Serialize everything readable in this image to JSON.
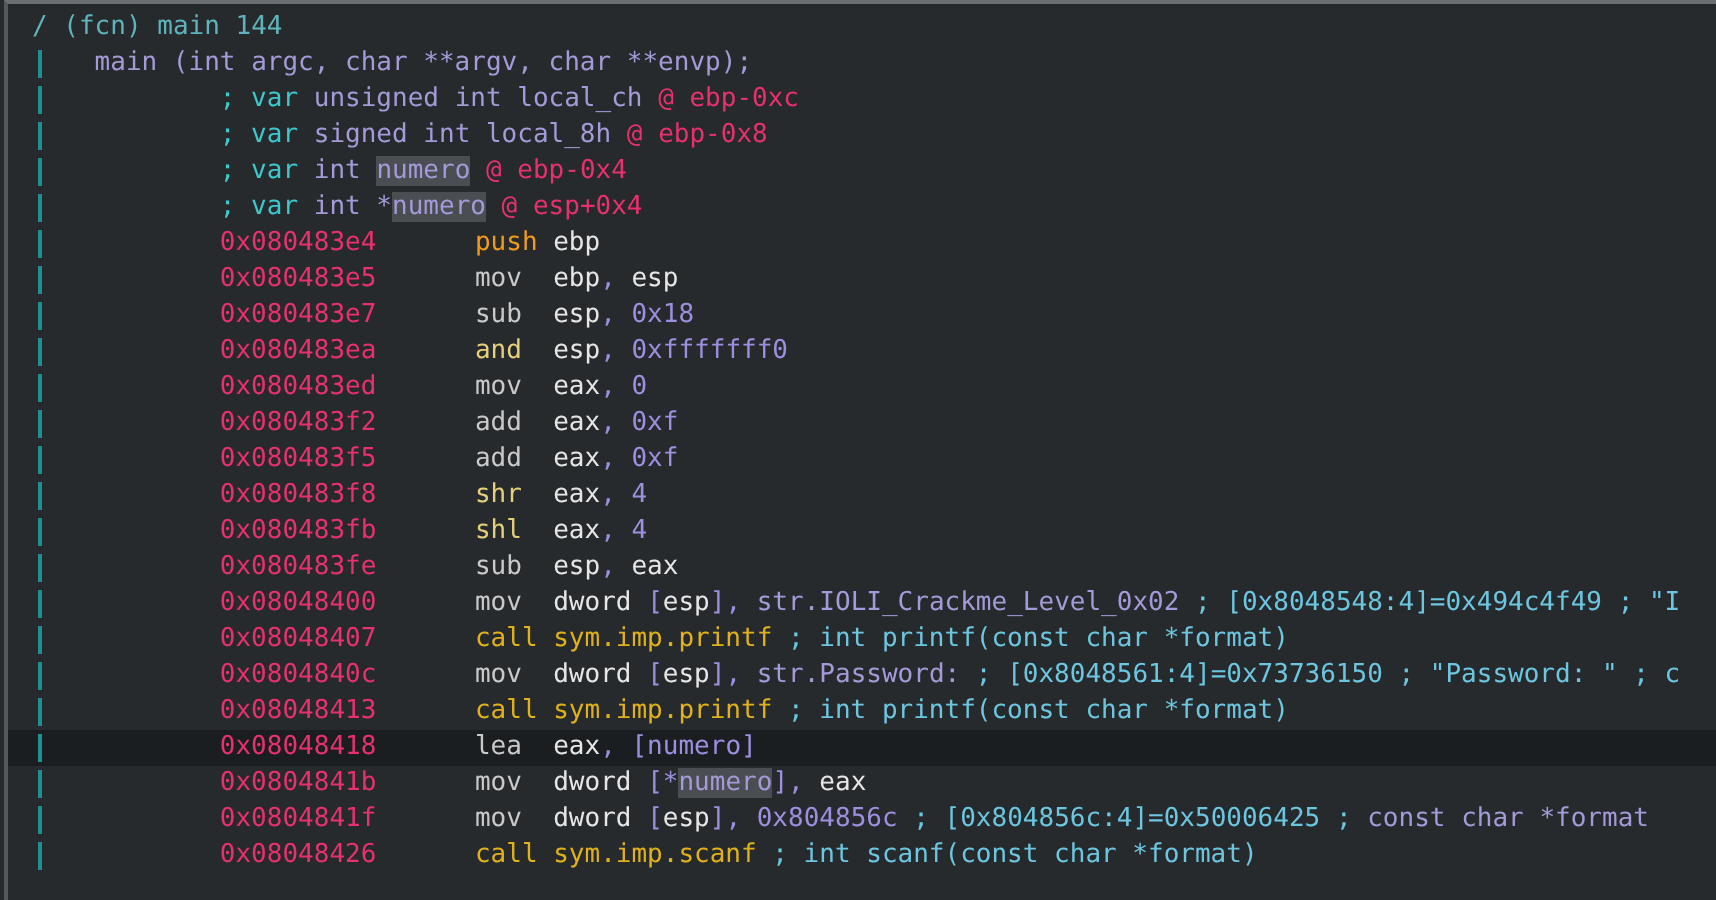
{
  "function": {
    "header": "/ (fcn) main 144",
    "signature": "main (int argc, char **argv, char **envp);",
    "variables": [
      [
        {
          "kind": "cmt",
          "text": "; var "
        },
        {
          "kind": "type",
          "text": "unsigned int local_ch "
        },
        {
          "kind": "loc",
          "text": "@ ebp-0xc"
        }
      ],
      [
        {
          "kind": "cmt",
          "text": "; var "
        },
        {
          "kind": "type",
          "text": "signed int local_8h "
        },
        {
          "kind": "loc",
          "text": "@ ebp-0x8"
        }
      ],
      [
        {
          "kind": "cmt",
          "text": "; var "
        },
        {
          "kind": "type",
          "text": "int "
        },
        {
          "kind": "hl",
          "text": "numero"
        },
        {
          "kind": "loc",
          "text": " @ ebp-0x4"
        }
      ],
      [
        {
          "kind": "cmt",
          "text": "; var "
        },
        {
          "kind": "type",
          "text": "int *"
        },
        {
          "kind": "hl",
          "text": "numero"
        },
        {
          "kind": "loc",
          "text": " @ esp+0x4"
        }
      ]
    ],
    "instructions": [
      {
        "address": "0x080483e4",
        "mnemonic": "push",
        "kind": "stack",
        "selected": false,
        "operands": [
          {
            "kind": "reg",
            "text": "ebp"
          }
        ]
      },
      {
        "address": "0x080483e5",
        "mnemonic": "mov",
        "kind": "move",
        "selected": false,
        "operands": [
          {
            "kind": "reg",
            "text": "ebp"
          },
          {
            "kind": "pun",
            "text": ", "
          },
          {
            "kind": "reg",
            "text": "esp"
          }
        ]
      },
      {
        "address": "0x080483e7",
        "mnemonic": "sub",
        "kind": "move",
        "selected": false,
        "operands": [
          {
            "kind": "reg",
            "text": "esp"
          },
          {
            "kind": "pun",
            "text": ", "
          },
          {
            "kind": "num",
            "text": "0x18"
          }
        ]
      },
      {
        "address": "0x080483ea",
        "mnemonic": "and",
        "kind": "logic",
        "selected": false,
        "operands": [
          {
            "kind": "reg",
            "text": "esp"
          },
          {
            "kind": "pun",
            "text": ", "
          },
          {
            "kind": "num",
            "text": "0xfffffff0"
          }
        ]
      },
      {
        "address": "0x080483ed",
        "mnemonic": "mov",
        "kind": "move",
        "selected": false,
        "operands": [
          {
            "kind": "reg",
            "text": "eax"
          },
          {
            "kind": "pun",
            "text": ", "
          },
          {
            "kind": "num",
            "text": "0"
          }
        ]
      },
      {
        "address": "0x080483f2",
        "mnemonic": "add",
        "kind": "move",
        "selected": false,
        "operands": [
          {
            "kind": "reg",
            "text": "eax"
          },
          {
            "kind": "pun",
            "text": ", "
          },
          {
            "kind": "num",
            "text": "0xf"
          }
        ]
      },
      {
        "address": "0x080483f5",
        "mnemonic": "add",
        "kind": "move",
        "selected": false,
        "operands": [
          {
            "kind": "reg",
            "text": "eax"
          },
          {
            "kind": "pun",
            "text": ", "
          },
          {
            "kind": "num",
            "text": "0xf"
          }
        ]
      },
      {
        "address": "0x080483f8",
        "mnemonic": "shr",
        "kind": "logic",
        "selected": false,
        "operands": [
          {
            "kind": "reg",
            "text": "eax"
          },
          {
            "kind": "pun",
            "text": ", "
          },
          {
            "kind": "num",
            "text": "4"
          }
        ]
      },
      {
        "address": "0x080483fb",
        "mnemonic": "shl",
        "kind": "logic",
        "selected": false,
        "operands": [
          {
            "kind": "reg",
            "text": "eax"
          },
          {
            "kind": "pun",
            "text": ", "
          },
          {
            "kind": "num",
            "text": "4"
          }
        ]
      },
      {
        "address": "0x080483fe",
        "mnemonic": "sub",
        "kind": "move",
        "selected": false,
        "operands": [
          {
            "kind": "reg",
            "text": "esp"
          },
          {
            "kind": "pun",
            "text": ", "
          },
          {
            "kind": "reg",
            "text": "eax"
          }
        ]
      },
      {
        "address": "0x08048400",
        "mnemonic": "mov",
        "kind": "move",
        "selected": false,
        "operands": [
          {
            "kind": "reg",
            "text": "dword "
          },
          {
            "kind": "pun",
            "text": "["
          },
          {
            "kind": "reg",
            "text": "esp"
          },
          {
            "kind": "pun",
            "text": "], "
          },
          {
            "kind": "str",
            "text": "str.IOLI_Crackme_Level_0x02"
          }
        ],
        "comment": [
          {
            "kind": "cmt",
            "text": "; [0x8048548:4]=0x494c4f49 ; \"I"
          }
        ]
      },
      {
        "address": "0x08048407",
        "mnemonic": "call",
        "kind": "call",
        "selected": false,
        "operands": [
          {
            "kind": "sym",
            "text": "sym.imp.printf"
          }
        ],
        "comment": [
          {
            "kind": "cmt",
            "text": "; int printf(const char *format)"
          }
        ]
      },
      {
        "address": "0x0804840c",
        "mnemonic": "mov",
        "kind": "move",
        "selected": false,
        "operands": [
          {
            "kind": "reg",
            "text": "dword "
          },
          {
            "kind": "pun",
            "text": "["
          },
          {
            "kind": "reg",
            "text": "esp"
          },
          {
            "kind": "pun",
            "text": "], "
          },
          {
            "kind": "str",
            "text": "str.Password:"
          }
        ],
        "comment": [
          {
            "kind": "cmt",
            "text": "; [0x8048561:4]=0x73736150 ; \"Password: \" ; c"
          }
        ]
      },
      {
        "address": "0x08048413",
        "mnemonic": "call",
        "kind": "call",
        "selected": false,
        "operands": [
          {
            "kind": "sym",
            "text": "sym.imp.printf"
          }
        ],
        "comment": [
          {
            "kind": "cmt",
            "text": "; int printf(const char *format)"
          }
        ]
      },
      {
        "address": "0x08048418",
        "mnemonic": "lea",
        "kind": "move",
        "selected": true,
        "operands": [
          {
            "kind": "reg",
            "text": "eax"
          },
          {
            "kind": "pun",
            "text": ", [numero]"
          }
        ]
      },
      {
        "address": "0x0804841b",
        "mnemonic": "mov",
        "kind": "move",
        "selected": false,
        "operands": [
          {
            "kind": "reg",
            "text": "dword "
          },
          {
            "kind": "pun",
            "text": "[*"
          },
          {
            "kind": "hl",
            "text": "numero"
          },
          {
            "kind": "pun",
            "text": "], "
          },
          {
            "kind": "reg",
            "text": "eax"
          }
        ]
      },
      {
        "address": "0x0804841f",
        "mnemonic": "mov",
        "kind": "move",
        "selected": false,
        "operands": [
          {
            "kind": "reg",
            "text": "dword "
          },
          {
            "kind": "pun",
            "text": "["
          },
          {
            "kind": "reg",
            "text": "esp"
          },
          {
            "kind": "pun",
            "text": "], "
          },
          {
            "kind": "num",
            "text": "0x804856c"
          }
        ],
        "comment": [
          {
            "kind": "cmt",
            "text": "; [0x804856c:4]=0x50006425 ; "
          },
          {
            "kind": "str",
            "text": "const char *format"
          }
        ]
      },
      {
        "address": "0x08048426",
        "mnemonic": "call",
        "kind": "call",
        "selected": false,
        "operands": [
          {
            "kind": "sym",
            "text": "sym.imp.scanf"
          }
        ],
        "comment": [
          {
            "kind": "cmt",
            "text": "; int scanf(const char *format)"
          }
        ]
      }
    ]
  }
}
